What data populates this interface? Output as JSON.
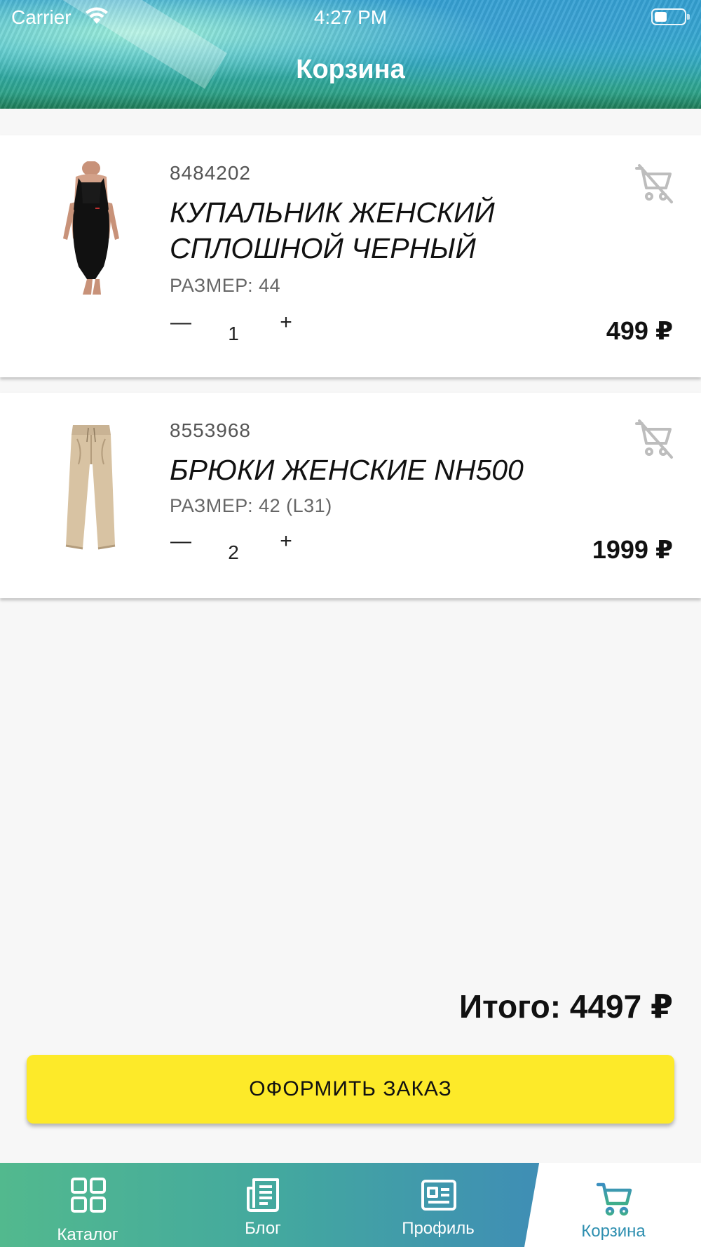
{
  "status_bar": {
    "carrier": "Carrier",
    "time": "4:27 PM"
  },
  "header": {
    "title": "Корзина"
  },
  "cart": {
    "items": [
      {
        "sku": "8484202",
        "name": "КУПАЛЬНИК ЖЕНСКИЙ СПЛОШНОЙ ЧЕРНЫЙ",
        "size": "РАЗМЕР: 44",
        "quantity": "1",
        "minus": "—",
        "plus": "+",
        "price": "499 ₽",
        "image": "black-swimsuit",
        "remove_icon": "remove-from-cart-icon"
      },
      {
        "sku": "8553968",
        "name": "БРЮКИ ЖЕНСКИЕ NH500",
        "size": "РАЗМЕР: 42 (L31)",
        "quantity": "2",
        "minus": "—",
        "plus": "+",
        "price": "1999 ₽",
        "image": "beige-trousers",
        "remove_icon": "remove-from-cart-icon"
      }
    ],
    "total": "Итого: 4497 ₽",
    "checkout_label": "ОФОРМИТЬ ЗАКАЗ"
  },
  "tab_bar": {
    "tabs": [
      {
        "label": "Каталог",
        "icon": "grid-icon",
        "active": false
      },
      {
        "label": "Блог",
        "icon": "document-icon",
        "active": false
      },
      {
        "label": "Профиль",
        "icon": "id-card-icon",
        "active": false
      },
      {
        "label": "Корзина",
        "icon": "cart-icon",
        "active": true
      }
    ]
  },
  "colors": {
    "checkout_button": "#fdea29",
    "active_tab": "#2e8fb0",
    "tab_bar_start": "#52b98e",
    "tab_bar_end": "#4a8ec6"
  }
}
